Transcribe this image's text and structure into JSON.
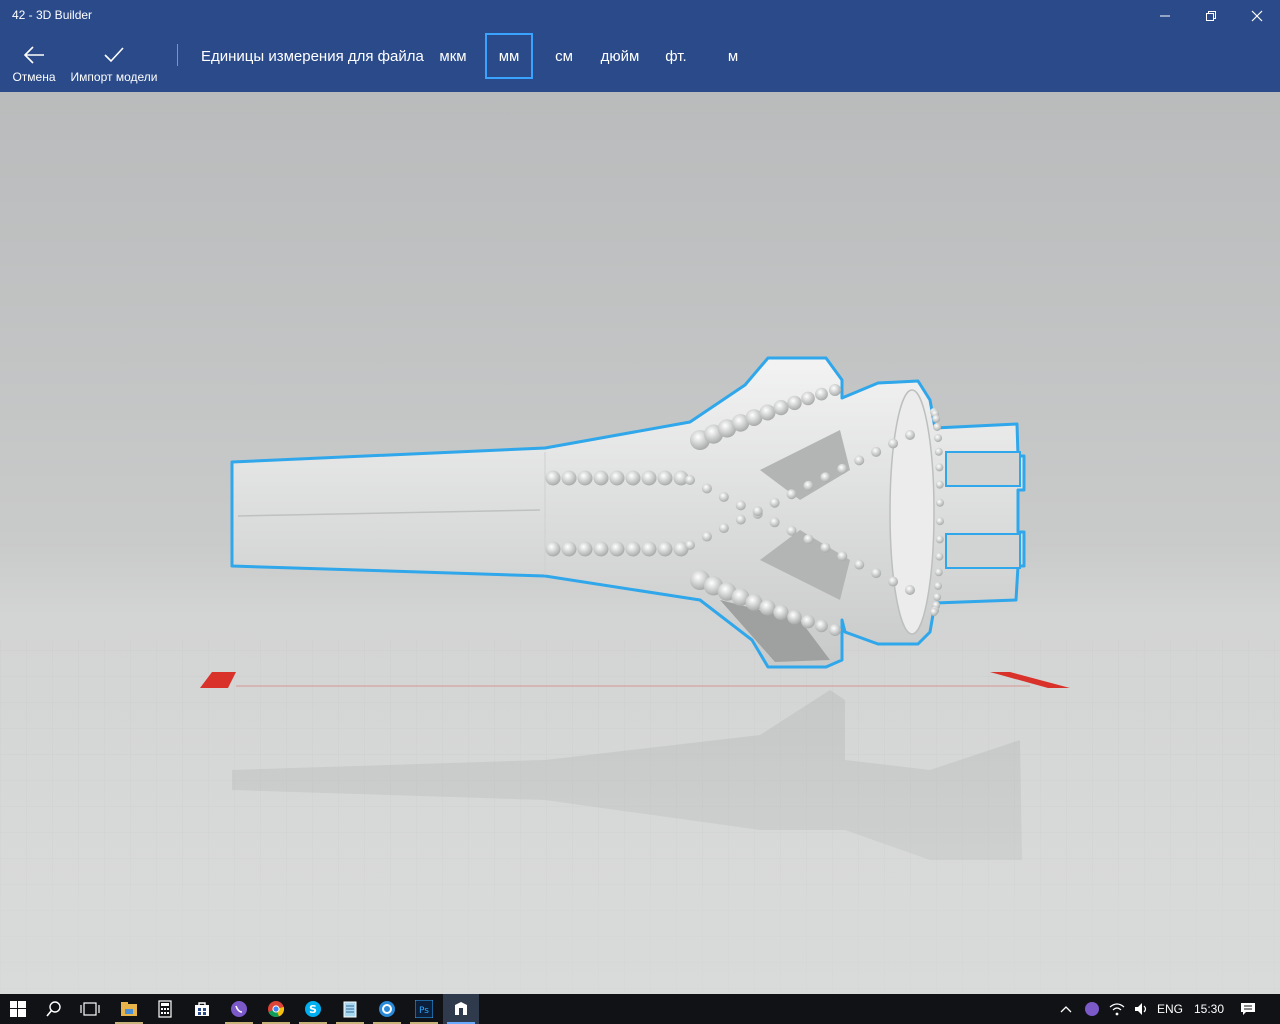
{
  "window": {
    "title": "42 - 3D Builder"
  },
  "toolbar": {
    "cancel_label": "Отмена",
    "import_label": "Импорт модели",
    "units_label": "Единицы измерения для файла",
    "units": [
      {
        "label": "мкм",
        "selected": false
      },
      {
        "label": "мм",
        "selected": true
      },
      {
        "label": "см",
        "selected": false
      },
      {
        "label": "дюйм",
        "selected": false
      },
      {
        "label": "фт.",
        "selected": false
      },
      {
        "label": "м",
        "selected": false
      }
    ]
  },
  "colors": {
    "titlebar": "#2a4a8a",
    "selection_outline": "#3aa2ff",
    "model_surface": "#e3e4e4",
    "floor": "#d4d5d5",
    "axis_marker": "#d9322b",
    "taskbar": "#101216"
  },
  "taskbar": {
    "apps": [
      {
        "name": "start-icon"
      },
      {
        "name": "search-icon"
      },
      {
        "name": "task-view-icon"
      },
      {
        "name": "file-explorer-icon"
      },
      {
        "name": "calculator-icon"
      },
      {
        "name": "store-icon"
      },
      {
        "name": "viber-icon"
      },
      {
        "name": "chrome-icon"
      },
      {
        "name": "skype-icon"
      },
      {
        "name": "notepad-icon"
      },
      {
        "name": "app-icon"
      },
      {
        "name": "photoshop-icon",
        "label": "Ps"
      },
      {
        "name": "3d-builder-icon"
      }
    ],
    "tray": {
      "language": "ENG",
      "time": "15:30"
    }
  }
}
